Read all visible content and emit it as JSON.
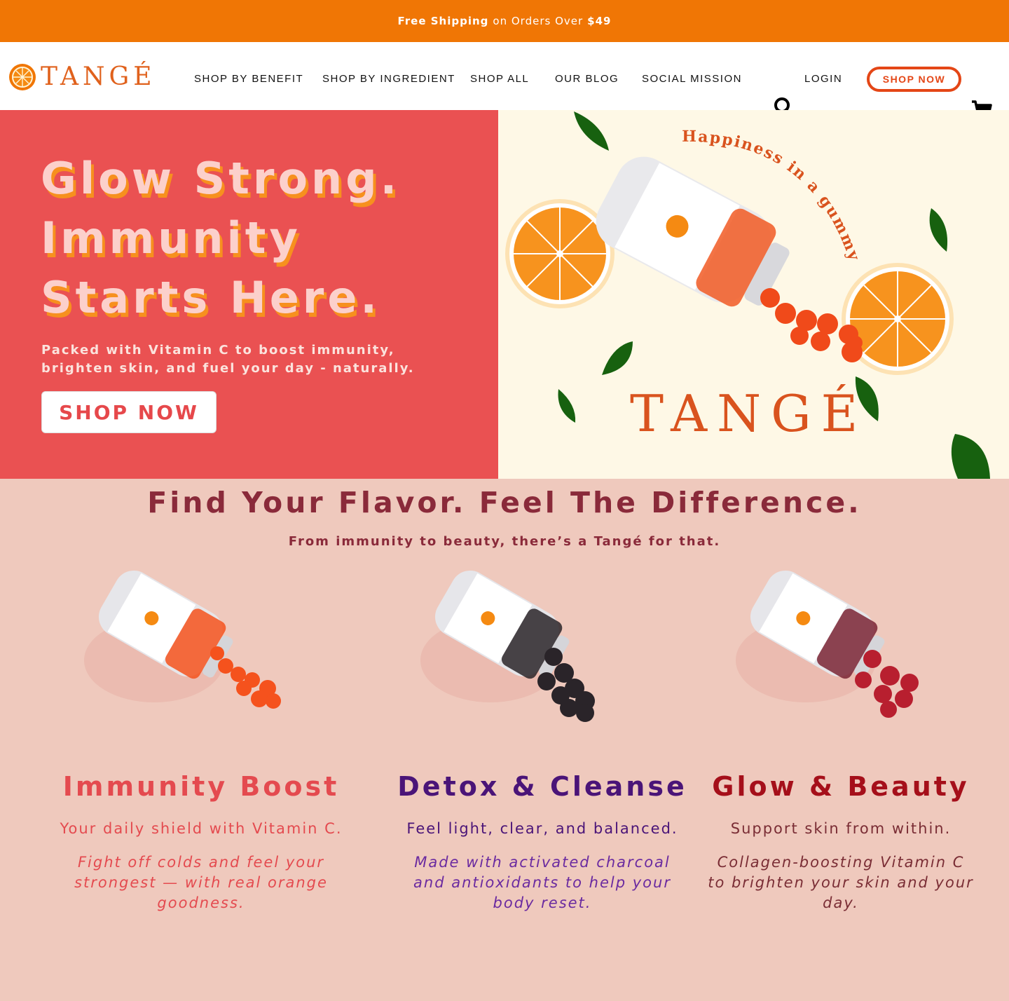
{
  "announcement": {
    "bold_start": "Free Shipping",
    "middle": "on Orders Over",
    "bold_end": "$49"
  },
  "header": {
    "logo_text": "TANGÉ",
    "nav": [
      "SHOP BY BENEFIT",
      "SHOP BY INGREDIENT",
      "SHOP ALL",
      "OUR BLOG",
      "SOCIAL MISSION"
    ],
    "login": "LOGIN",
    "shop_now": "SHOP NOW",
    "icons": [
      "orange-logo-icon",
      "search-icon",
      "cart-icon"
    ]
  },
  "hero": {
    "title_lines": [
      "Glow Strong.",
      "Immunity",
      "Starts Here."
    ],
    "subtitle_lines": [
      "Packed with Vitamin C to boost immunity,",
      "brighten skin, and fuel your day - naturally."
    ],
    "cta": "SHOP NOW",
    "image_tagline": "Happiness in a gummy.",
    "image_brand": "TANGÉ"
  },
  "section": {
    "title": "Find Your Flavor. Feel The Difference.",
    "subtitle": "From immunity to beauty, there’s a Tangé for that."
  },
  "products": [
    {
      "title": "Immunity Boost",
      "tagline": "Your daily shield with Vitamin C.",
      "description": "Fight off colds and feel your strongest — with real orange goodness.",
      "color": "#e44a4f",
      "gummy_color": "#f5521d"
    },
    {
      "title": "Detox & Cleanse",
      "tagline": "Feel light, clear, and balanced.",
      "description": "Made with activated charcoal and antioxidants to help your body reset.",
      "color": "#4a1478",
      "desc_color": "#6a2aa0",
      "gummy_color": "#2a2429"
    },
    {
      "title": "Glow & Beauty",
      "tagline": "Support skin from within.",
      "description": "Collagen-boosting Vitamin C to brighten your skin and your day.",
      "color": "#a50f1a",
      "tagline_color": "#7a2d35",
      "desc_color": "#7a2d35",
      "gummy_color": "#b81f2f"
    }
  ],
  "colors": {
    "topbar": "#f07605",
    "hero_left": "#ea5152",
    "hero_right": "#fef8e6",
    "section_bg": "#efc9bd",
    "accent": "#e44616"
  }
}
